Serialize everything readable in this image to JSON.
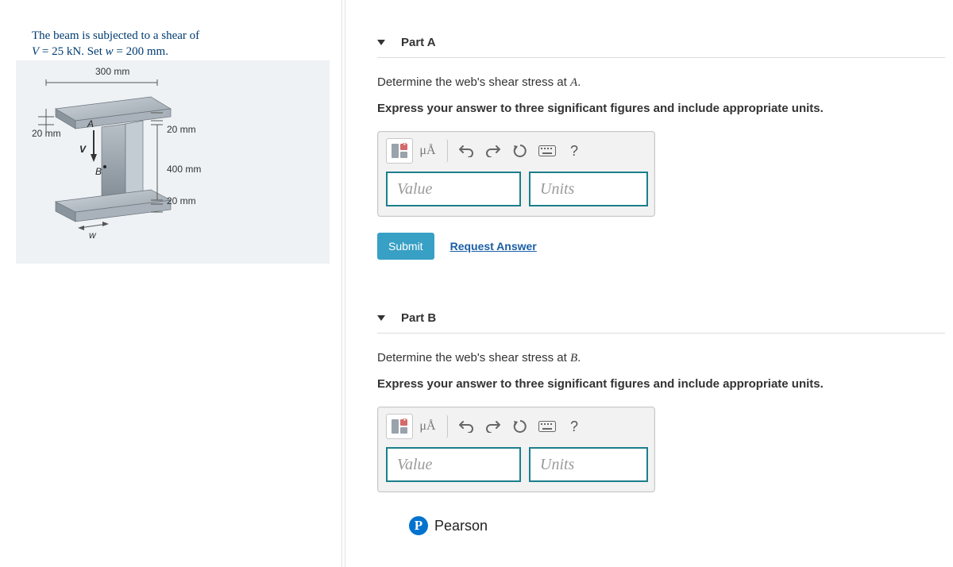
{
  "problem": {
    "line1_html": "The beam is subjected to a shear of",
    "line2_prefix": "V",
    "line2_eq1": " = 25 kN",
    "line2_mid": ". Set ",
    "line2_var2": "w",
    "line2_eq2": " = 200 mm",
    "line2_suffix": "."
  },
  "figure": {
    "top_label": "300 mm",
    "left_dim": "20 mm",
    "right_dim_top": "20 mm",
    "right_dim_mid": "400 mm",
    "right_dim_bot": "20 mm",
    "point_A": "A",
    "point_B": "B",
    "force_V": "V",
    "bottom_w": "w"
  },
  "parts": [
    {
      "title": "Part A",
      "question_pre": "Determine the web's shear stress at ",
      "question_var": "A",
      "question_post": ".",
      "instruction": "Express your answer to three significant figures and include appropriate units.",
      "value_placeholder": "Value",
      "units_placeholder": "Units",
      "submit": "Submit",
      "request": "Request Answer"
    },
    {
      "title": "Part B",
      "question_pre": "Determine the web's shear stress at ",
      "question_var": "B",
      "question_post": ".",
      "instruction": "Express your answer to three significant figures and include appropriate units.",
      "value_placeholder": "Value",
      "units_placeholder": "Units",
      "submit": "Submit",
      "request": "Request Answer"
    }
  ],
  "toolbar": {
    "templates_tip": "templates",
    "special_text": "μÅ",
    "undo_tip": "undo",
    "redo_tip": "redo",
    "reset_tip": "reset",
    "keyboard_tip": "keyboard",
    "help_text": "?"
  },
  "brand": "Pearson"
}
